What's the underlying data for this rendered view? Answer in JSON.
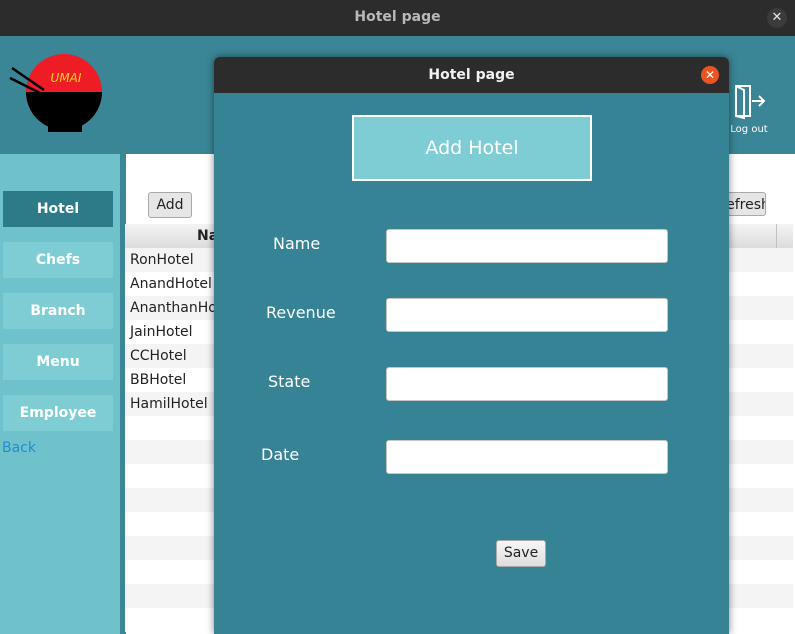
{
  "window": {
    "title": "Hotel page",
    "close_glyph": "✕"
  },
  "header": {
    "logo_text": "UMAI",
    "logo_icon": "bowl-chopsticks-logo",
    "logout_label": "Log out",
    "logout_icon": "door-exit-icon"
  },
  "sidebar": {
    "items": [
      {
        "label": "Hotel",
        "active": true
      },
      {
        "label": "Chefs",
        "active": false
      },
      {
        "label": "Branch",
        "active": false
      },
      {
        "label": "Menu",
        "active": false
      },
      {
        "label": "Employee",
        "active": false
      }
    ],
    "back_label": "Back"
  },
  "toolbar": {
    "add_label": "Add",
    "refresh_label": "Refresh"
  },
  "table": {
    "columns": [
      "Name"
    ],
    "rows": [
      "RonHotel",
      "AnandHotel",
      "AnanthanHotel",
      "JainHotel",
      "CCHotel",
      "BBHotel",
      "HamilHotel"
    ]
  },
  "dialog": {
    "title": "Hotel page",
    "close_glyph": "✕",
    "heading": "Add Hotel",
    "fields": [
      {
        "label": "Name",
        "value": ""
      },
      {
        "label": "Revenue",
        "value": ""
      },
      {
        "label": "State",
        "value": ""
      },
      {
        "label": "Date",
        "value": ""
      }
    ],
    "save_label": "Save"
  },
  "colors": {
    "header": "#3a8696",
    "sidebar": "#6fc2cc",
    "nav_button": "#7fcdd4",
    "nav_active": "#2d7a89",
    "dialog_body": "#358394",
    "dialog_close": "#e95420",
    "logo_red": "#ee1c25"
  }
}
